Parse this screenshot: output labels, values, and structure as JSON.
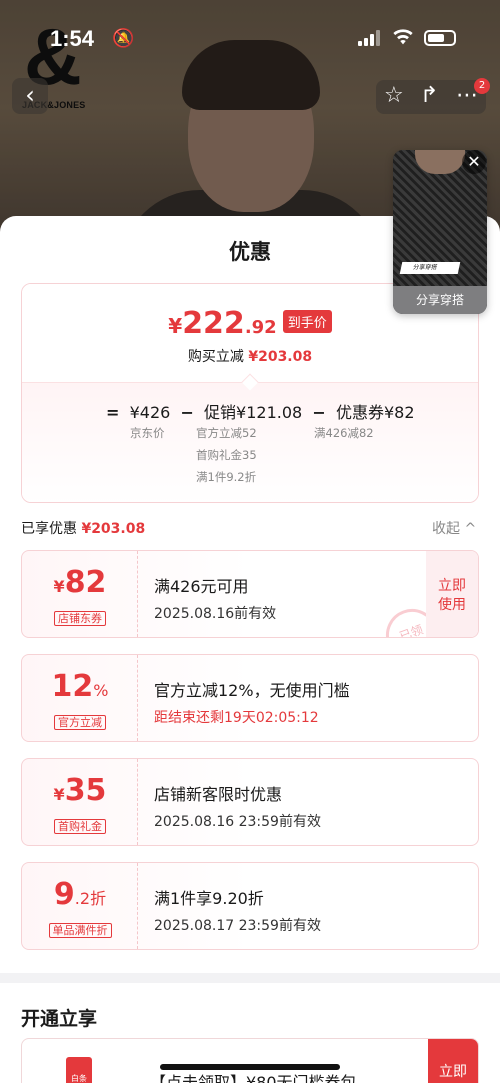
{
  "status_bar": {
    "time": "1:54"
  },
  "brand": {
    "logo_text": "JACK&JONES"
  },
  "header": {
    "cart_badge": "2"
  },
  "float_card": {
    "mini_label": "分享穿搭",
    "share_label": "分享穿搭"
  },
  "sheet": {
    "title": "优惠",
    "summary": {
      "currency": "¥",
      "price_int": "222",
      "price_dec": ".92",
      "price_tag": "到手价",
      "reduce_label": "购买立减",
      "reduce_amount": "¥203.08",
      "formula": {
        "eq": "=",
        "jd_price": "¥426",
        "minus1": "−",
        "promo": "促销¥121.08",
        "minus2": "−",
        "coupon": "优惠券¥82"
      },
      "jd_price_label": "京东价",
      "promo_items": [
        "官方立减52",
        "首购礼金35",
        "满1件9.2折"
      ],
      "coupon_detail": "满426减82"
    },
    "enjoyed": {
      "label": "已享优惠",
      "amount": "¥203.08",
      "collapse": "收起 ^"
    },
    "coupons": [
      {
        "currency": "¥",
        "value": "82",
        "suffix": "",
        "tag": "店铺东券",
        "line1": "满426元可用",
        "line2": "2025.08.16前有效",
        "line2_red": false,
        "action": "立即使用",
        "stamp": "已领"
      },
      {
        "currency": "",
        "value": "12",
        "suffix": "%",
        "tag": "官方立减",
        "line1": "官方立减12%，无使用门槛",
        "line2": "距结束还剩19天02:05:12",
        "line2_red": true
      },
      {
        "currency": "¥",
        "value": "35",
        "suffix": "",
        "tag": "首购礼金",
        "line1": "店铺新客限时优惠",
        "line2": "2025.08.16 23:59前有效",
        "line2_red": false
      },
      {
        "currency": "",
        "value": "9",
        "suffix": ".2折",
        "tag": "单品满件折",
        "line1": "满1件享9.20折",
        "line2": "2025.08.17 23:59前有效",
        "line2_red": false
      }
    ],
    "open_section": {
      "title": "开通立享",
      "icon_text": "白条",
      "item_text": "【点击领取】¥80无门槛券包",
      "button": "立即"
    }
  },
  "colors": {
    "accent": "#e4393c",
    "card_border": "#f6d2d5"
  },
  "icons": [
    "back-icon",
    "star-icon",
    "share-icon",
    "more-icon",
    "close-icon",
    "bell-mute-icon",
    "wifi-icon",
    "battery-icon"
  ]
}
